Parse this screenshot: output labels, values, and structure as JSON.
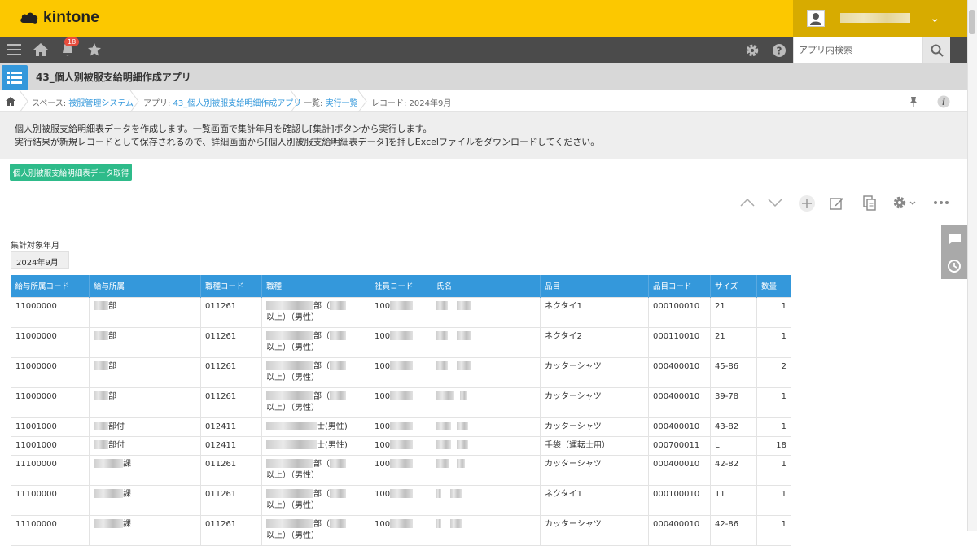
{
  "brand": {
    "name": "kintone",
    "color": "#fcc800"
  },
  "nav": {
    "notification_count": "18",
    "search_placeholder": "アプリ内検索"
  },
  "app": {
    "title": "43_個人別被服支給明細作成アプリ"
  },
  "breadcrumb": [
    {
      "prefix": "スペース: ",
      "link": "被服管理システム"
    },
    {
      "prefix": "アプリ: ",
      "link": "43_個人別被服支給明細作成アプリ"
    },
    {
      "prefix": "一覧: ",
      "link": "実行一覧"
    },
    {
      "prefix": "レコード: 2024年9月",
      "link": ""
    }
  ],
  "description": {
    "line1": "個人別被服支給明細表データを作成します。一覧画面で集計年月を確認し[集計]ボタンから実行します。",
    "line2": "実行結果が新規レコードとして保存されるので、詳細画面から[個人別被服支給明細表データ]を押しExcelファイルをダウンロードしてください。"
  },
  "action_button": "個人別被服支給明細表データ取得",
  "field": {
    "label": "集計対象年月",
    "value": "2024年9月"
  },
  "table": {
    "headers": [
      "給与所属コード",
      "給与所属",
      "職種コード",
      "職種",
      "社員コード",
      "氏名",
      "品目",
      "品目コード",
      "サイズ",
      "数量"
    ],
    "rows": [
      {
        "dept_code": "11000000",
        "dept": "部",
        "job_code": "011261",
        "job": "部（",
        "job2": "以上）（男性）",
        "emp": "100",
        "item": "ネクタイ1",
        "item_code": "000100010",
        "size": "21",
        "qty": "1"
      },
      {
        "dept_code": "11000000",
        "dept": "部",
        "job_code": "011261",
        "job": "部（",
        "job2": "以上）（男性）",
        "emp": "100",
        "item": "ネクタイ2",
        "item_code": "000110010",
        "size": "21",
        "qty": "1"
      },
      {
        "dept_code": "11000000",
        "dept": "部",
        "job_code": "011261",
        "job": "部（",
        "job2": "以上）（男性）",
        "emp": "100",
        "item": "カッターシャツ",
        "item_code": "000400010",
        "size": "45-86",
        "qty": "2"
      },
      {
        "dept_code": "11000000",
        "dept": "部",
        "job_code": "011261",
        "job": "部（",
        "job2": "以上）（男性）",
        "emp": "100",
        "item": "カッターシャツ",
        "item_code": "000400010",
        "size": "39-78",
        "qty": "1"
      },
      {
        "dept_code": "11001000",
        "dept": "部付",
        "job_code": "012411",
        "job": "士(男性)",
        "job2": "",
        "emp": "100",
        "item": "カッターシャツ",
        "item_code": "000400010",
        "size": "43-82",
        "qty": "1"
      },
      {
        "dept_code": "11001000",
        "dept": "部付",
        "job_code": "012411",
        "job": "士(男性)",
        "job2": "",
        "emp": "100",
        "item": "手袋（運転士用）",
        "item_code": "000700011",
        "size": "L",
        "qty": "18"
      },
      {
        "dept_code": "11100000",
        "dept": "課",
        "job_code": "011261",
        "job": "部（",
        "job2": "以上）（男性）",
        "emp": "100",
        "item": "カッターシャツ",
        "item_code": "000400010",
        "size": "42-82",
        "qty": "1"
      },
      {
        "dept_code": "11100000",
        "dept": "課",
        "job_code": "011261",
        "job": "部（",
        "job2": "以上）（男性）",
        "emp": "100",
        "item": "ネクタイ1",
        "item_code": "000100010",
        "size": "11",
        "qty": "1"
      },
      {
        "dept_code": "11100000",
        "dept": "課",
        "job_code": "011261",
        "job": "部（",
        "job2": "以上）（男性）",
        "emp": "100",
        "item": "カッターシャツ",
        "item_code": "000400010",
        "size": "42-86",
        "qty": "1"
      }
    ]
  },
  "colors": {
    "accent": "#3498db",
    "header_bg": "#fcc800",
    "nav_bg": "#4b4b4b",
    "action_green": "#2ebb8a"
  },
  "icons": [
    "menu-icon",
    "home-icon",
    "bell-icon",
    "star-icon",
    "gear-icon",
    "help-icon",
    "search-icon",
    "list-icon",
    "pin-icon",
    "info-icon",
    "chevron-up-icon",
    "chevron-down-icon",
    "add-icon",
    "edit-icon",
    "copy-icon",
    "more-icon",
    "comment-icon",
    "history-icon"
  ]
}
